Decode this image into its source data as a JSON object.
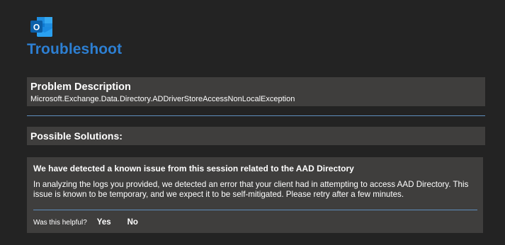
{
  "app": {
    "logo_icon": "outlook-icon",
    "logo_letter": "O",
    "title": "Troubleshoot",
    "accent_color": "#2d7fd2"
  },
  "problem": {
    "heading": "Problem Description",
    "text": "Microsoft.Exchange.Data.Directory.ADDriverStoreAccessNonLocalException"
  },
  "solutions": {
    "heading": "Possible Solutions:"
  },
  "issue": {
    "heading": "We have detected a known issue from this session related to the AAD Directory",
    "body": "In analyzing the logs you provided, we detected an error that your client had in attempting to access AAD Directory. This issue is known to be temporary, and we expect it to be self-mitigated. Please retry after a few minutes.",
    "feedback_question": "Was this helpful?",
    "yes_label": "Yes",
    "no_label": "No"
  }
}
